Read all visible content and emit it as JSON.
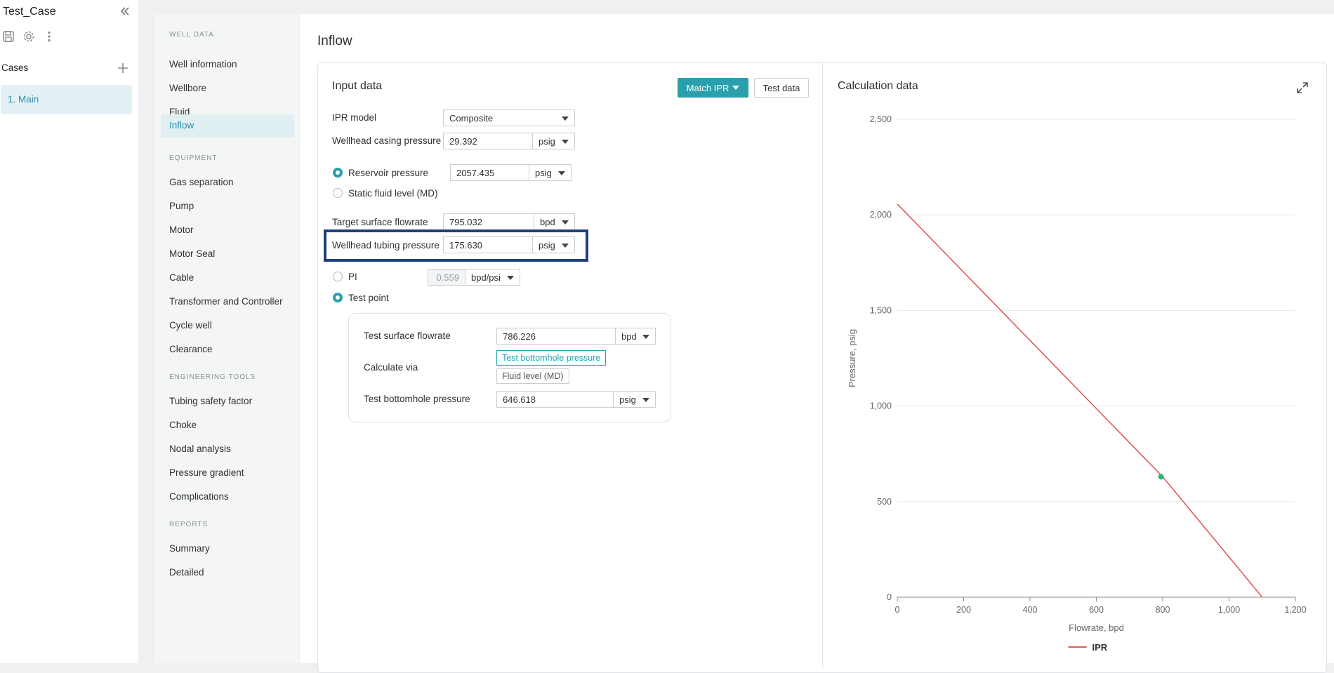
{
  "project": {
    "title": "Test_Case",
    "cases_label": "Cases",
    "cases": [
      {
        "label": "1. Main"
      }
    ]
  },
  "nav": {
    "sections": [
      {
        "title": "WELL DATA",
        "items": [
          "Well information",
          "Wellbore",
          "Fluid",
          "Inflow"
        ]
      },
      {
        "title": "EQUIPMENT",
        "items": [
          "Gas separation",
          "Pump",
          "Motor",
          "Motor Seal",
          "Cable",
          "Transformer and Controller",
          "Cycle well",
          "Clearance"
        ]
      },
      {
        "title": "ENGINEERING TOOLS",
        "items": [
          "Tubing safety factor",
          "Choke",
          "Nodal analysis",
          "Pressure gradient",
          "Complications"
        ]
      },
      {
        "title": "REPORTS",
        "items": [
          "Summary",
          "Detailed"
        ]
      }
    ],
    "active": "Inflow"
  },
  "page": {
    "title": "Inflow"
  },
  "input": {
    "title": "Input data",
    "match_ipr_label": "Match IPR",
    "test_data_label": "Test data",
    "ipr_model": {
      "label": "IPR model",
      "value": "Composite"
    },
    "wellhead_casing_pressure": {
      "label": "Wellhead casing pressure",
      "value": "29.392",
      "unit": "psig"
    },
    "reservoir_pressure": {
      "label": "Reservoir pressure",
      "value": "2057.435",
      "unit": "psig",
      "selected": true
    },
    "static_fluid_level": {
      "label": "Static fluid level (MD)",
      "selected": false
    },
    "target_surface_flowrate": {
      "label": "Target surface flowrate",
      "value": "795.032",
      "unit": "bpd"
    },
    "wellhead_tubing_pressure": {
      "label": "Wellhead tubing pressure",
      "value": "175.630",
      "unit": "psig"
    },
    "pi": {
      "label": "PI",
      "value": "0.559",
      "unit": "bpd/psi",
      "selected": false
    },
    "test_point": {
      "label": "Test point",
      "selected": true,
      "test_surface_flowrate": {
        "label": "Test surface flowrate",
        "value": "786.226",
        "unit": "bpd"
      },
      "calculate_via": {
        "label": "Calculate via",
        "options": [
          "Test bottomhole pressure",
          "Fluid level (MD)"
        ],
        "selected": "Test bottomhole pressure"
      },
      "test_bottomhole_pressure": {
        "label": "Test bottomhole pressure",
        "value": "646.618",
        "unit": "psig"
      }
    }
  },
  "calc": {
    "title": "Calculation data"
  },
  "colors": {
    "accent": "#2aa0ad",
    "ipr_line": "#e05a5a",
    "test_point": "#2bb673",
    "highlight": "#1f3f7f"
  },
  "chart_data": {
    "type": "line",
    "xlabel": "Flowrate, bpd",
    "ylabel": "Pressure, psig",
    "xlim": [
      0,
      1200
    ],
    "ylim": [
      0,
      2500
    ],
    "xticks": [
      0,
      200,
      400,
      600,
      800,
      1000,
      1200
    ],
    "xtick_labels": [
      "0",
      "200",
      "400",
      "600",
      "800",
      "1,000",
      "1,200"
    ],
    "yticks": [
      0,
      500,
      1000,
      1500,
      2000,
      2500
    ],
    "ytick_labels": [
      "0",
      "500",
      "1,000",
      "1,500",
      "2,000",
      "2,500"
    ],
    "grid": "horizontal",
    "legend_position": "bottom-center",
    "series": [
      {
        "name": "IPR",
        "x": [
          0,
          800,
          1100
        ],
        "y": [
          2057,
          630,
          0
        ]
      }
    ],
    "points": [
      {
        "x": 795,
        "y": 630
      }
    ]
  }
}
